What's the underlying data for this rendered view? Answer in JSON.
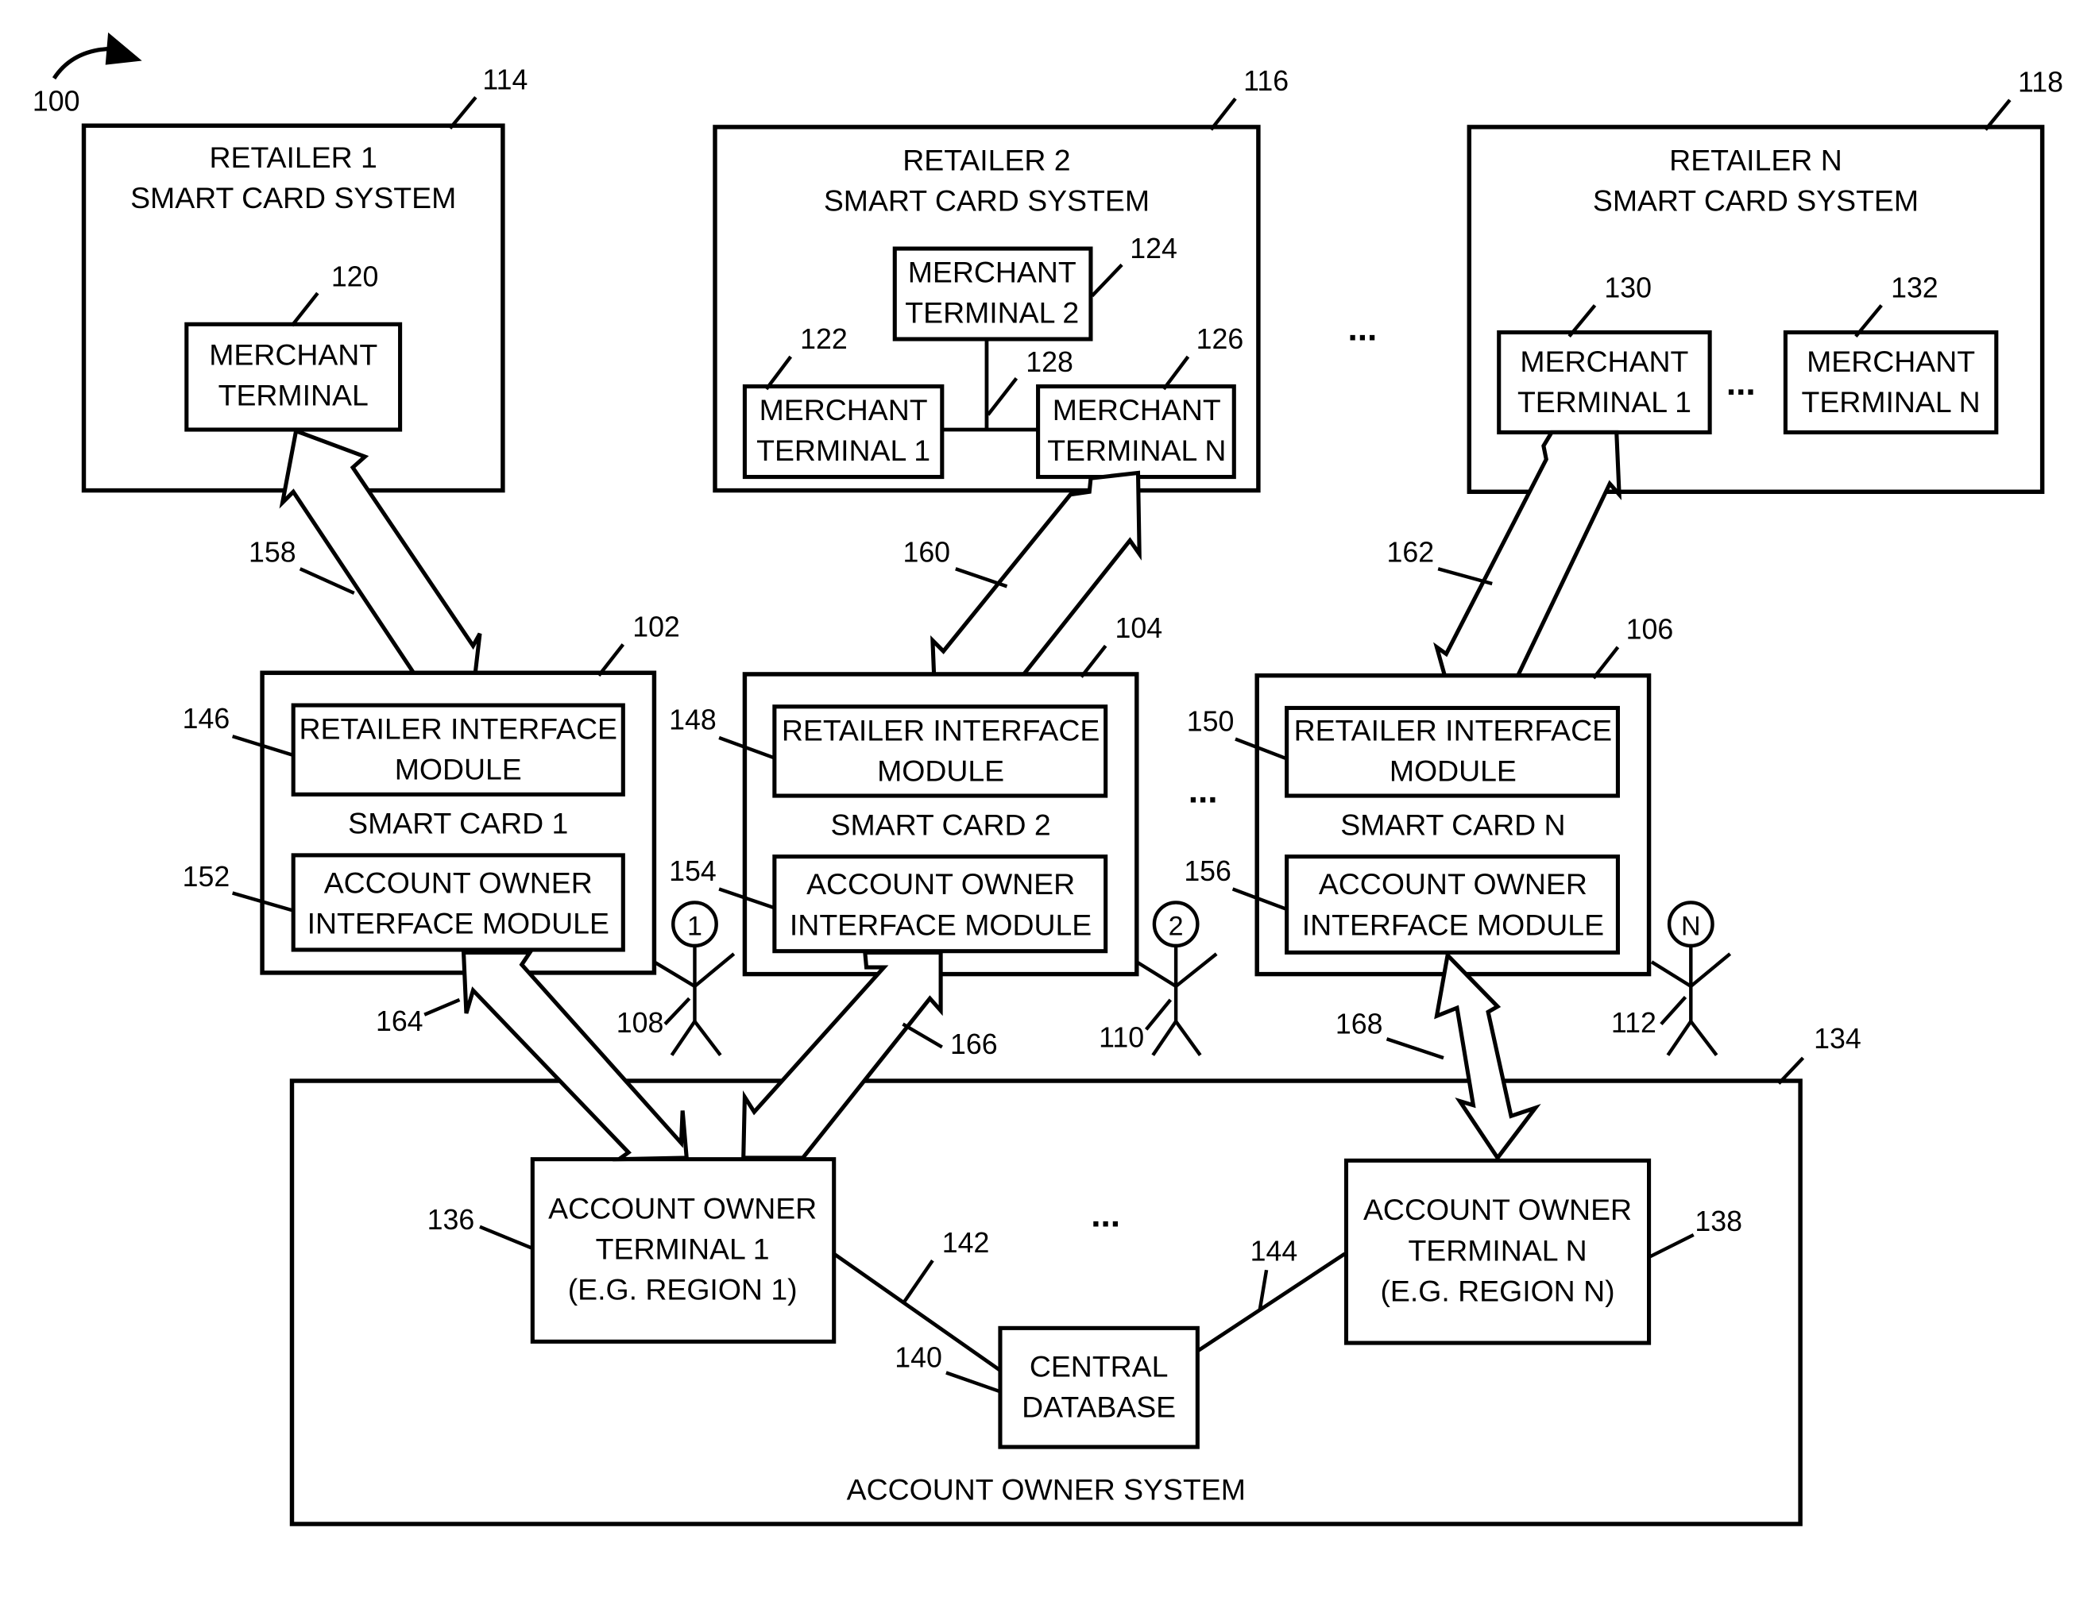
{
  "figure_number": "100",
  "retailers": [
    {
      "ref": "114",
      "title_line1": "RETAILER 1",
      "title_line2": "SMART CARD SYSTEM",
      "terminals": [
        {
          "ref": "120",
          "line1": "MERCHANT",
          "line2": "TERMINAL"
        }
      ]
    },
    {
      "ref": "116",
      "title_line1": "RETAILER 2",
      "title_line2": "SMART CARD SYSTEM",
      "terminals": [
        {
          "ref": "122",
          "line1": "MERCHANT",
          "line2": "TERMINAL 1"
        },
        {
          "ref": "124",
          "line1": "MERCHANT",
          "line2": "TERMINAL 2"
        },
        {
          "ref": "126",
          "line1": "MERCHANT",
          "line2": "TERMINAL N"
        }
      ],
      "network_ref": "128"
    },
    {
      "ref": "118",
      "title_line1": "RETAILER N",
      "title_line2": "SMART CARD SYSTEM",
      "terminals": [
        {
          "ref": "130",
          "line1": "MERCHANT",
          "line2": "TERMINAL 1"
        },
        {
          "ref": "132",
          "line1": "MERCHANT",
          "line2": "TERMINAL N"
        }
      ]
    }
  ],
  "smart_cards": [
    {
      "ref": "102",
      "title": "SMART CARD 1",
      "retailer_module": {
        "ref": "146",
        "line1": "RETAILER INTERFACE",
        "line2": "MODULE"
      },
      "owner_module": {
        "ref": "152",
        "line1": "ACCOUNT OWNER",
        "line2": "INTERFACE MODULE"
      },
      "user": {
        "ref": "108",
        "badge": "1"
      },
      "retailer_link_ref": "158",
      "owner_link_ref": "164"
    },
    {
      "ref": "104",
      "title": "SMART CARD 2",
      "retailer_module": {
        "ref": "148",
        "line1": "RETAILER INTERFACE",
        "line2": "MODULE"
      },
      "owner_module": {
        "ref": "154",
        "line1": "ACCOUNT OWNER",
        "line2": "INTERFACE MODULE"
      },
      "user": {
        "ref": "110",
        "badge": "2"
      },
      "retailer_link_ref": "160",
      "owner_link_ref": "166"
    },
    {
      "ref": "106",
      "title": "SMART CARD N",
      "retailer_module": {
        "ref": "150",
        "line1": "RETAILER INTERFACE",
        "line2": "MODULE"
      },
      "owner_module": {
        "ref": "156",
        "line1": "ACCOUNT OWNER",
        "line2": "INTERFACE MODULE"
      },
      "user": {
        "ref": "112",
        "badge": "N"
      },
      "retailer_link_ref": "162",
      "owner_link_ref": "168"
    }
  ],
  "account_owner_system": {
    "ref": "134",
    "title": "ACCOUNT OWNER SYSTEM",
    "terminal_1": {
      "ref": "136",
      "line1": "ACCOUNT OWNER",
      "line2": "TERMINAL 1",
      "line3": "(E.G. REGION 1)"
    },
    "terminal_n": {
      "ref": "138",
      "line1": "ACCOUNT OWNER",
      "line2": "TERMINAL N",
      "line3": "(E.G. REGION N)"
    },
    "database": {
      "ref": "140",
      "line1": "CENTRAL",
      "line2": "DATABASE"
    },
    "link_1_ref": "142",
    "link_n_ref": "144"
  },
  "ellipsis": "..."
}
